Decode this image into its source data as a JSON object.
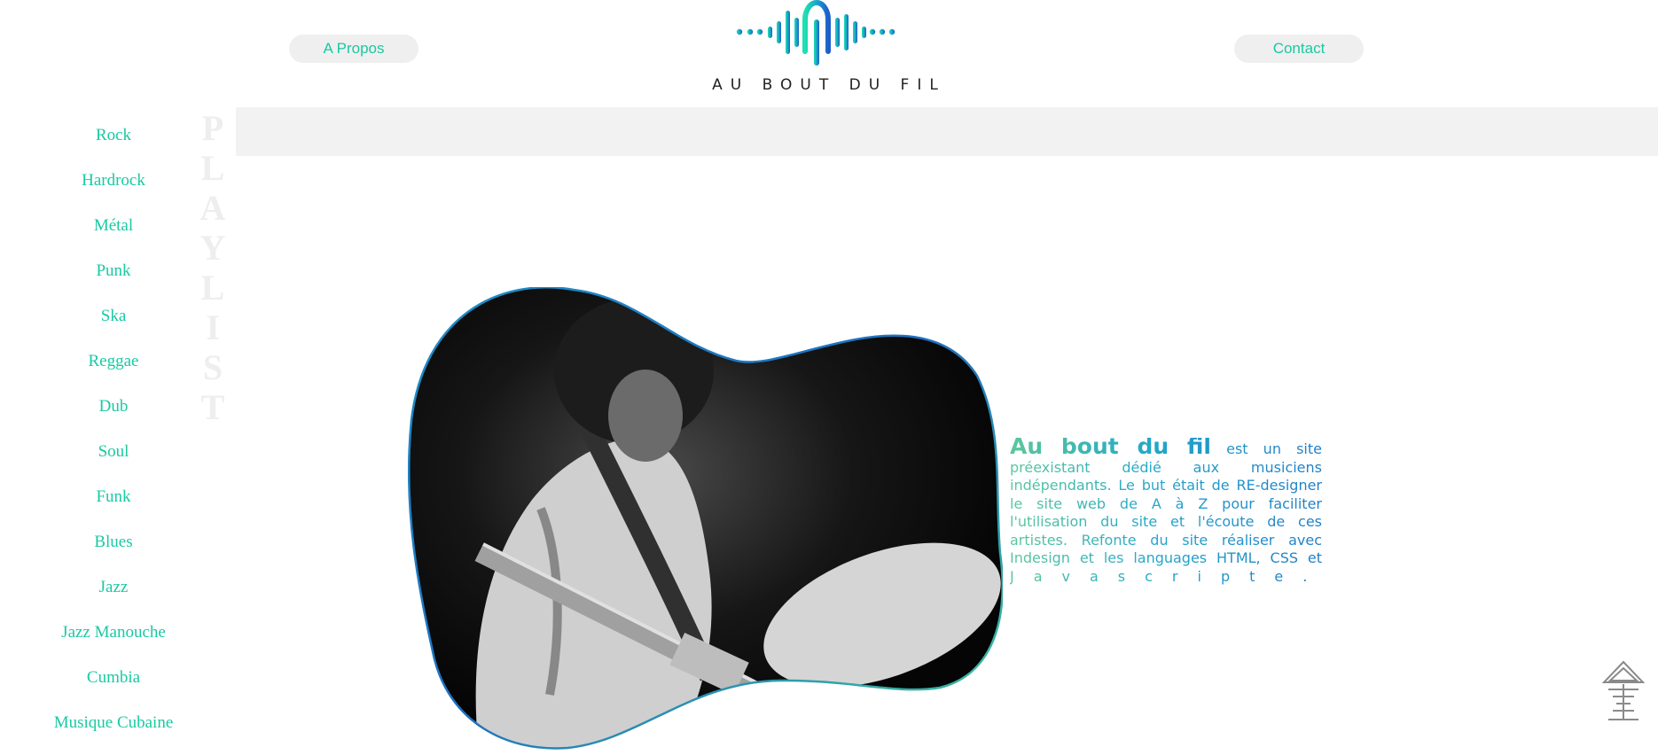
{
  "header": {
    "about_label": "A Propos",
    "contact_label": "Contact",
    "logo_text": "AU BOUT DU FIL"
  },
  "sidebar": {
    "vertical_title": [
      "P",
      "L",
      "A",
      "Y",
      "L",
      "I",
      "S",
      "T"
    ],
    "items": [
      {
        "label": "Rock"
      },
      {
        "label": "Hardrock"
      },
      {
        "label": "Métal"
      },
      {
        "label": "Punk"
      },
      {
        "label": "Ska"
      },
      {
        "label": "Reggae"
      },
      {
        "label": "Dub"
      },
      {
        "label": "Soul"
      },
      {
        "label": "Funk"
      },
      {
        "label": "Blues"
      },
      {
        "label": "Jazz"
      },
      {
        "label": "Jazz Manouche"
      },
      {
        "label": "Cumbia"
      },
      {
        "label": "Musique Cubaine"
      }
    ]
  },
  "main": {
    "brand": "Au bout du fil",
    "description": "est un site préexistant dédié aux musiciens indépendants. Le but était de RE-designer le site web de A à Z pour faciliter l'utilisation du site et l'écoute de ces artistes. Refonte du site réaliser avec Indesign et les languages HTML, CSS et",
    "last_word": "Javascripte."
  },
  "colors": {
    "accent": "#19c9a3",
    "gradient_start": "#5cc79b",
    "gradient_end": "#1e7dc8",
    "banner": "#f2f2f2",
    "pill": "#efefef"
  },
  "icons": {
    "logo": "sound-wave-logo-icon",
    "photo": "guitarist-photo",
    "scroll_top": "arrow-up-icon"
  }
}
